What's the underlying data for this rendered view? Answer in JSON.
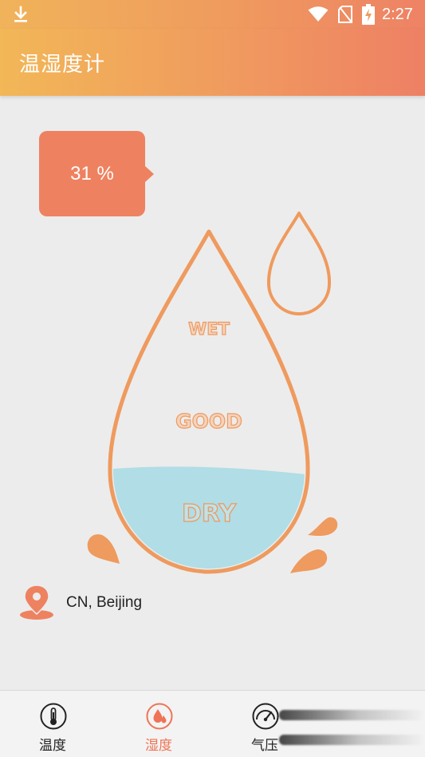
{
  "status_bar": {
    "time": "2:27",
    "icons": [
      "download-icon",
      "wifi-icon",
      "no-sim-icon",
      "battery-charging-icon"
    ]
  },
  "app_bar": {
    "title": "温湿度计"
  },
  "humidity": {
    "value": "31 %",
    "level": 0.31,
    "labels": {
      "wet": "WET",
      "good": "GOOD",
      "dry": "DRY"
    }
  },
  "location": {
    "city": "CN, Beijing",
    "icon": "location-pin-icon"
  },
  "bottom_nav": {
    "items": [
      {
        "label": "温度",
        "icon": "thermometer-icon",
        "active": false
      },
      {
        "label": "湿度",
        "icon": "humidity-drop-icon",
        "active": true
      },
      {
        "label": "气压",
        "icon": "pressure-gauge-icon",
        "active": false
      }
    ]
  },
  "colors": {
    "accent": "#ee8260",
    "water": "#b0dde6",
    "drop_outline": "#ef9a5e",
    "background": "#ececec"
  }
}
